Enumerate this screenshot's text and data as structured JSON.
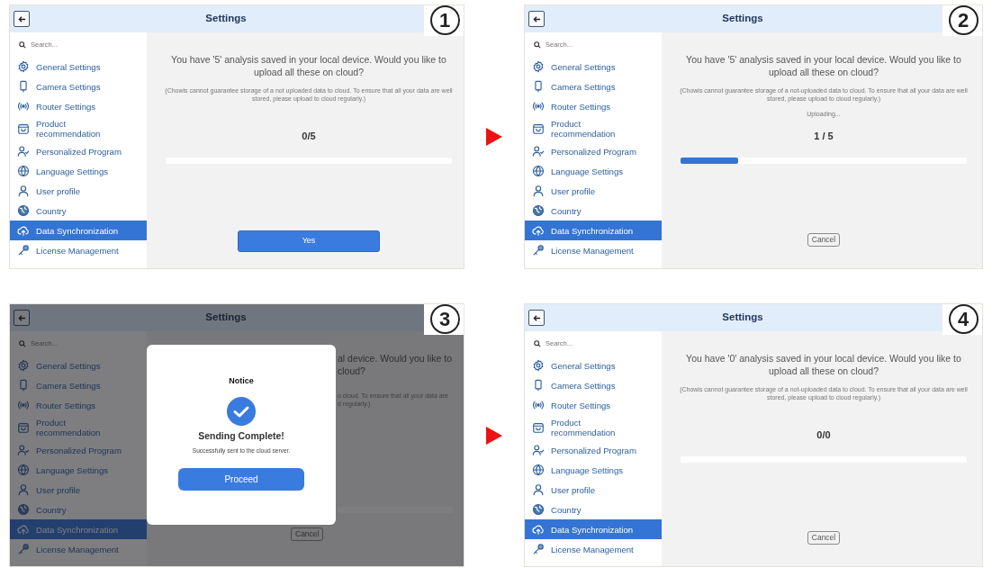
{
  "panels": [
    {
      "badge": "1",
      "header": {
        "title": "Settings"
      },
      "search": {
        "placeholder": "Search..."
      },
      "sidebar": {
        "items": [
          {
            "label": "General Settings",
            "selected": false
          },
          {
            "label": "Camera Settings",
            "selected": false
          },
          {
            "label": "Router Settings",
            "selected": false
          },
          {
            "label": "Product recommendation",
            "selected": false
          },
          {
            "label": "Personalized Program",
            "selected": false
          },
          {
            "label": "Language Settings",
            "selected": false
          },
          {
            "label": "User profile",
            "selected": false
          },
          {
            "label": "Country",
            "selected": false
          },
          {
            "label": "Data Synchronization",
            "selected": true
          },
          {
            "label": "License Management",
            "selected": false
          }
        ]
      },
      "content": {
        "message": "You have '5' analysis saved in your local device. Would you like to upload all these on cloud?",
        "note": "(Chowis cannot guarantee storage of a not uploaded data to cloud. To ensure that all your data are well stored, please upload to cloud regularly.)",
        "count": "0/5",
        "progress": {
          "level": 0
        },
        "button": {
          "kind": "primary",
          "label": "Yes"
        }
      }
    },
    {
      "badge": "2",
      "header": {
        "title": "Settings"
      },
      "search": {
        "placeholder": "Search..."
      },
      "sidebar": {
        "items": [
          {
            "label": "General Settings",
            "selected": false
          },
          {
            "label": "Camera Settings",
            "selected": false
          },
          {
            "label": "Router Settings",
            "selected": false
          },
          {
            "label": "Product recommendation",
            "selected": false
          },
          {
            "label": "Personalized Program",
            "selected": false
          },
          {
            "label": "Language Settings",
            "selected": false
          },
          {
            "label": "User profile",
            "selected": false
          },
          {
            "label": "Country",
            "selected": false
          },
          {
            "label": "Data Synchronization",
            "selected": true
          },
          {
            "label": "License Management",
            "selected": false
          }
        ]
      },
      "content": {
        "message": "You have '5' analysis saved in your local device. Would you like to upload all these on cloud?",
        "note": "(Chowis cannot guarantee storage of a not-uploaded data to cloud. To ensure that all your data are well stored, please upload to cloud regularly.)",
        "status": "Uploading...",
        "count": "1 / 5",
        "progress": {
          "level": 0.2
        },
        "button": {
          "kind": "outline",
          "label": "Cancel"
        }
      }
    },
    {
      "badge": "3",
      "header": {
        "title": "Settings"
      },
      "search": {
        "placeholder": "Search..."
      },
      "sidebar": {
        "items": [
          {
            "label": "General Settings",
            "selected": false
          },
          {
            "label": "Camera Settings",
            "selected": false
          },
          {
            "label": "Router Settings",
            "selected": false
          },
          {
            "label": "Product recommendation",
            "selected": false
          },
          {
            "label": "Personalized Program",
            "selected": false
          },
          {
            "label": "Language Settings",
            "selected": false
          },
          {
            "label": "User profile",
            "selected": false
          },
          {
            "label": "Country",
            "selected": false
          },
          {
            "label": "Data Synchronization",
            "selected": true
          },
          {
            "label": "License Management",
            "selected": false
          }
        ]
      },
      "content": {
        "message_fragments": [
          "al device. Would you like to",
          "cloud?"
        ],
        "note_fragments": [
          "o cloud. To ensure that all your data are",
          "d regularly.)"
        ],
        "progress": {
          "level": 0
        },
        "button": {
          "kind": "outline",
          "label": "Cancel"
        }
      },
      "modal": {
        "title": "Notice",
        "heading": "Sending Complete!",
        "text": "Successfully sent to the cloud server.",
        "button": "Proceed"
      }
    },
    {
      "badge": "4",
      "header": {
        "title": "Settings"
      },
      "search": {
        "placeholder": "Search..."
      },
      "sidebar": {
        "items": [
          {
            "label": "General Settings",
            "selected": false
          },
          {
            "label": "Camera Settings",
            "selected": false
          },
          {
            "label": "Router Settings",
            "selected": false
          },
          {
            "label": "Product recommendation",
            "selected": false
          },
          {
            "label": "Personalized Program",
            "selected": false
          },
          {
            "label": "Language Settings",
            "selected": false
          },
          {
            "label": "User profile",
            "selected": false
          },
          {
            "label": "Country",
            "selected": false
          },
          {
            "label": "Data Synchronization",
            "selected": true
          },
          {
            "label": "License Management",
            "selected": false
          }
        ]
      },
      "content": {
        "message": "You have '0' analysis saved in your local device. Would you like to upload all these on cloud?",
        "note": "(Chowis cannot guarantee storage of a not-uploaded data to cloud. To ensure that all your data are well stored, please upload to cloud regularly.)",
        "count": "0/0",
        "progress": {
          "level": 0
        },
        "button": {
          "kind": "outline",
          "label": "Cancel"
        }
      }
    }
  ]
}
